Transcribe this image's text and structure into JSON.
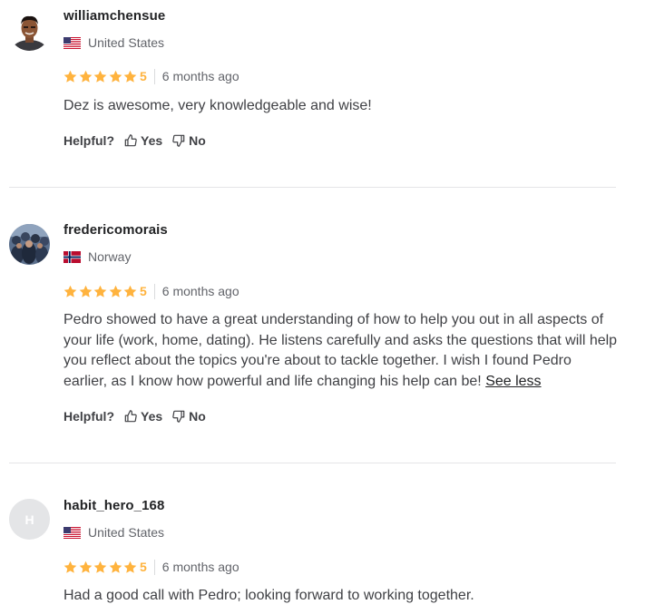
{
  "reviews": [
    {
      "username": "williamchensue",
      "country": "United States",
      "flag": "us",
      "rating": "5",
      "time": "6 months ago",
      "text": "Dez is awesome, very knowledgeable and wise!",
      "helpful_label": "Helpful?",
      "yes_label": "Yes",
      "no_label": "No"
    },
    {
      "username": "fredericomorais",
      "country": "Norway",
      "flag": "no",
      "rating": "5",
      "time": "6 months ago",
      "text": "Pedro showed to have a great understanding of how to help you out in all aspects of your life (work, home, dating). He listens carefully and asks the questions that will help you reflect about the topics you're about to tackle together. I wish I found Pedro earlier, as I know how powerful and life changing his help can be!",
      "see_less": "See less",
      "helpful_label": "Helpful?",
      "yes_label": "Yes",
      "no_label": "No"
    },
    {
      "username": "habit_hero_168",
      "avatar_letter": "H",
      "country": "United States",
      "flag": "us",
      "rating": "5",
      "time": "6 months ago",
      "text": "Had a good call with Pedro; looking forward to working together."
    }
  ],
  "colors": {
    "star": "#ffb33e",
    "divider": "#e4e5e7",
    "text": "#404145",
    "muted": "#62646a"
  }
}
